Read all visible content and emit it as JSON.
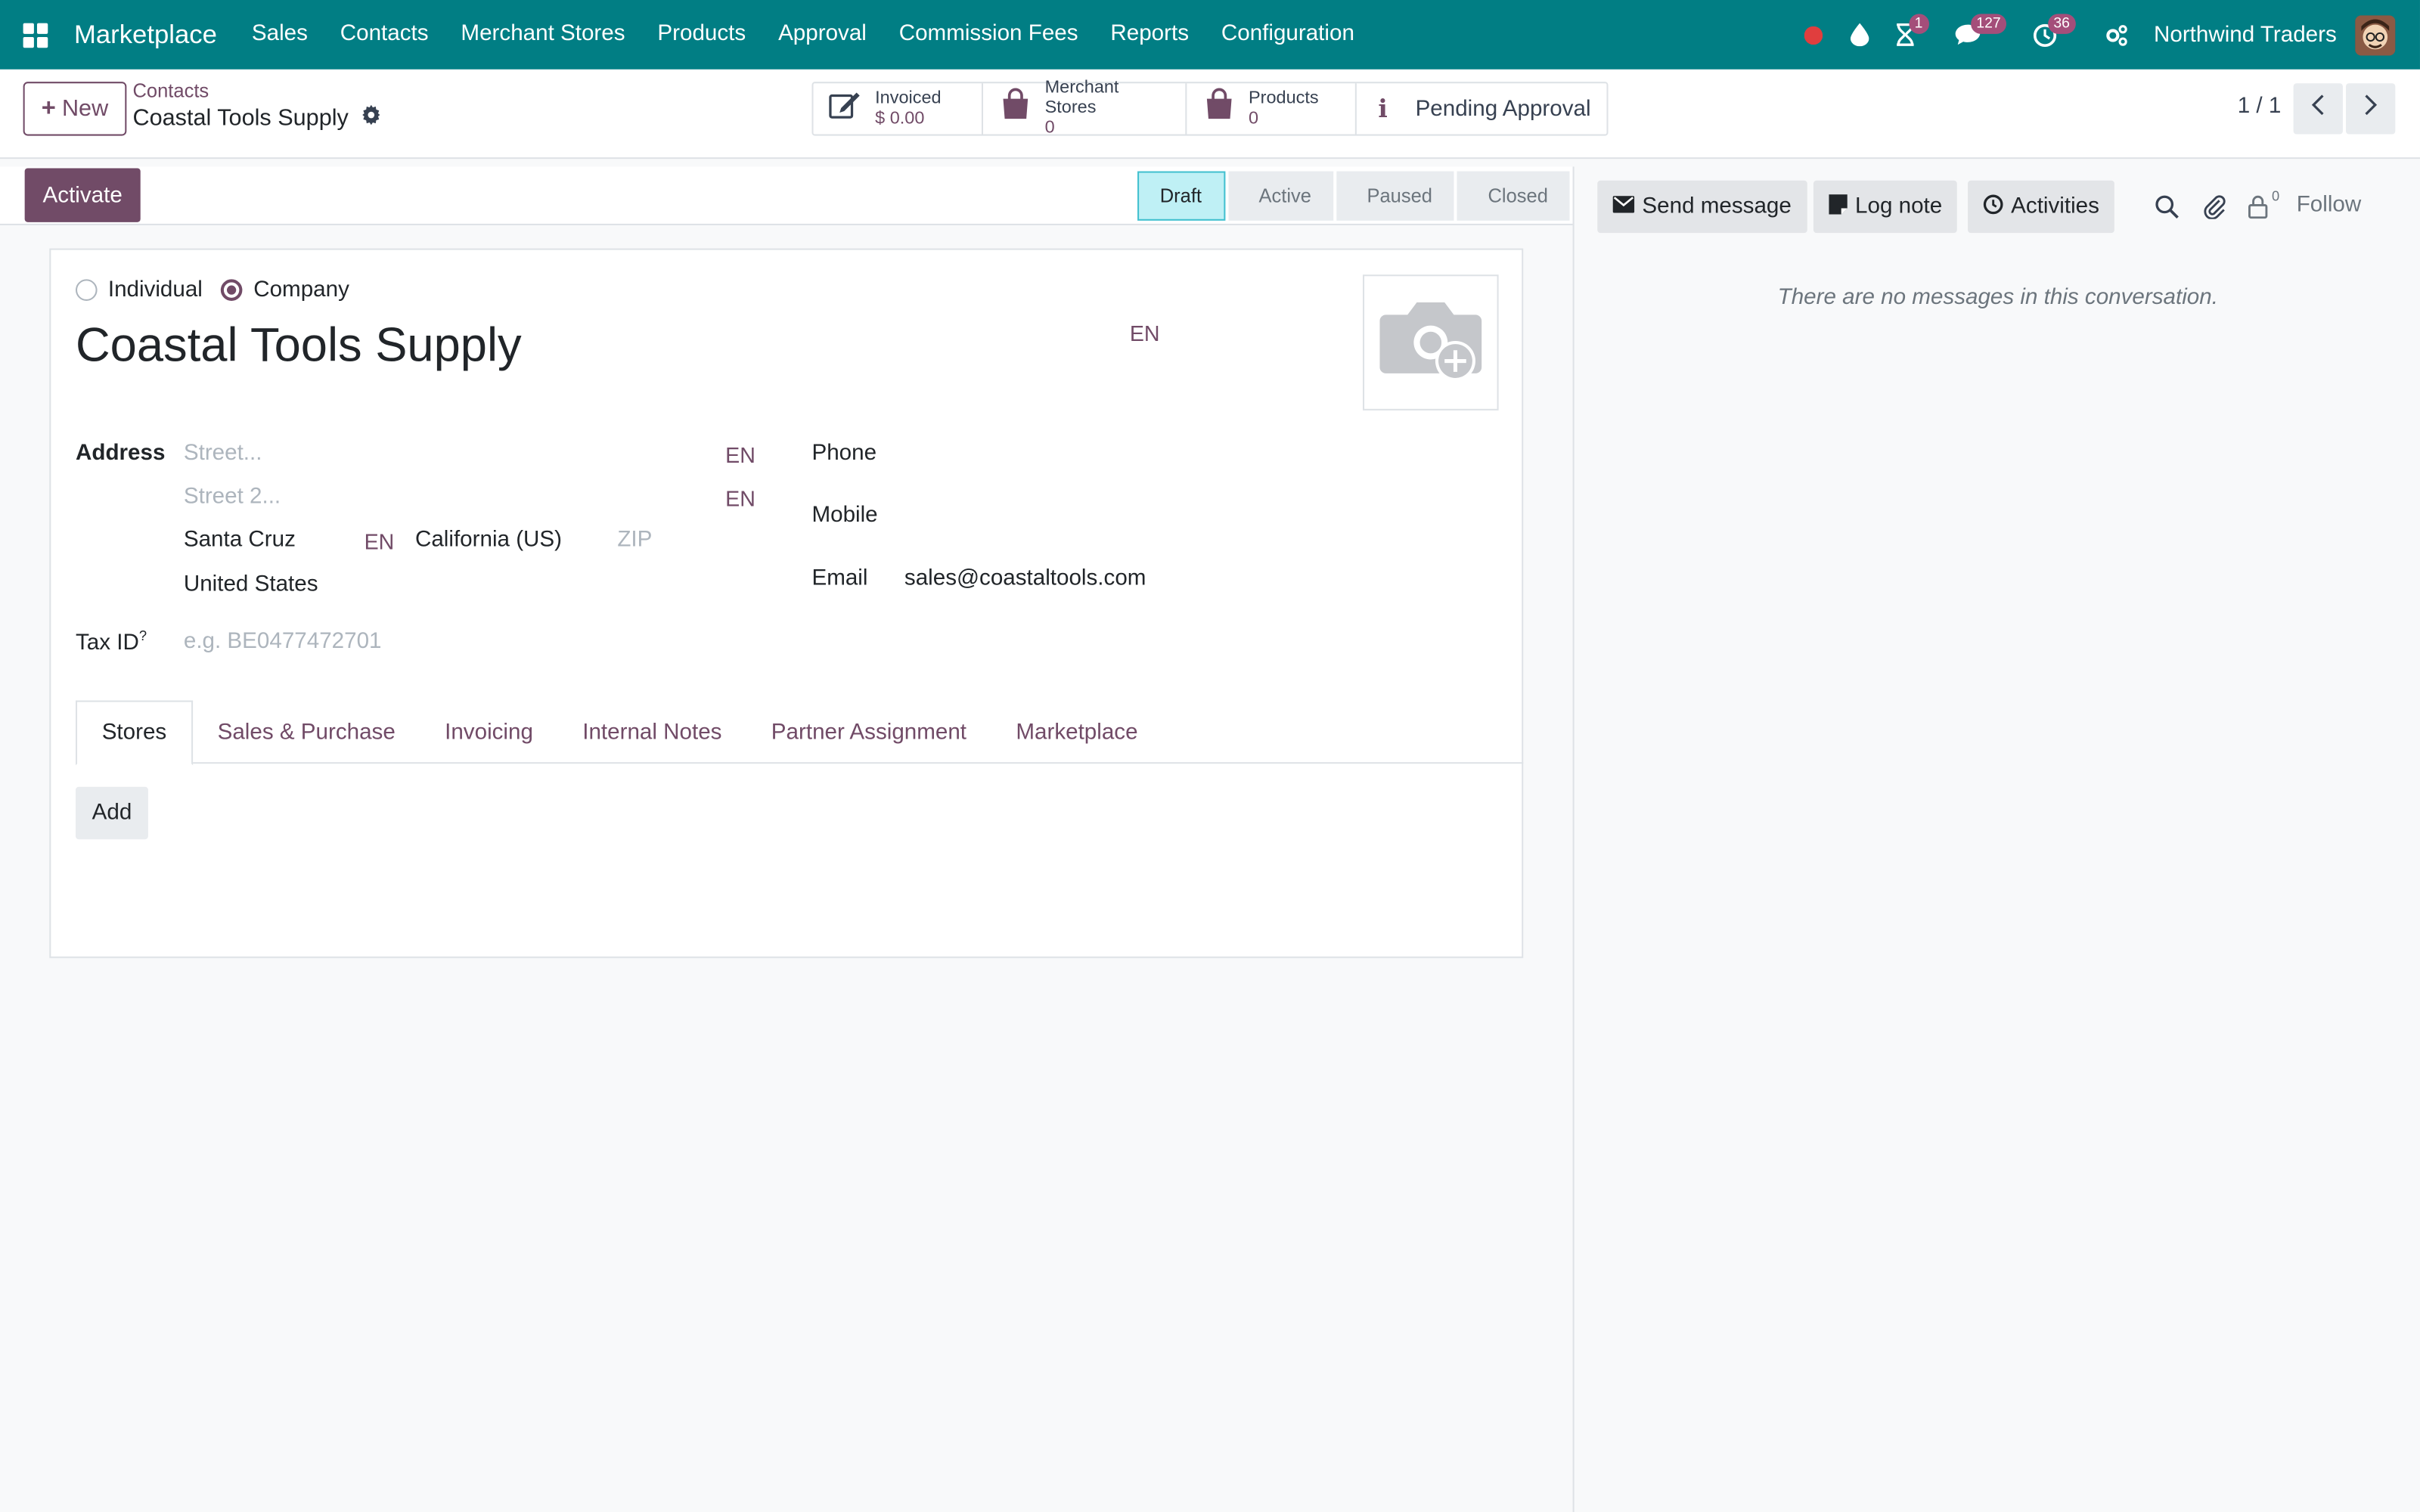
{
  "navbar": {
    "brand": "Marketplace",
    "menu": [
      "Sales",
      "Contacts",
      "Merchant Stores",
      "Products",
      "Approval",
      "Commission Fees",
      "Reports",
      "Configuration"
    ],
    "activity_badge": "1",
    "messages_badge": "127",
    "clock_badge": "36",
    "company": "Northwind Traders",
    "icons": [
      "apps-icon",
      "recording-dot-icon",
      "drop-icon",
      "hourglass-icon",
      "chat-icon",
      "clock-icon",
      "settings-icon"
    ]
  },
  "control": {
    "new_label": "New",
    "breadcrumb_parent": "Contacts",
    "breadcrumb_current": "Coastal Tools Supply",
    "stats": {
      "invoiced_label": "Invoiced",
      "invoiced_value": "$ 0.00",
      "stores_label": "Merchant Stores",
      "stores_value": "0",
      "products_label": "Products",
      "products_value": "0",
      "pending_label": "Pending Approval"
    },
    "pager": "1 / 1"
  },
  "statusbar": {
    "activate_label": "Activate",
    "stages": [
      "Draft",
      "Active",
      "Paused",
      "Closed"
    ],
    "current_stage": "Draft"
  },
  "form": {
    "type_individual": "Individual",
    "type_company": "Company",
    "selected_type": "Company",
    "name": "Coastal Tools Supply",
    "lang_tag": "EN",
    "address_label": "Address",
    "street_placeholder": "Street...",
    "street2_placeholder": "Street 2...",
    "city": "Santa Cruz",
    "state": "California (US)",
    "zip_placeholder": "ZIP",
    "country": "United States",
    "tax_label": "Tax ID",
    "tax_help": "?",
    "tax_placeholder": "e.g. BE0477472701",
    "phone_label": "Phone",
    "mobile_label": "Mobile",
    "email_label": "Email",
    "email": "sales@coastaltools.com"
  },
  "tabs": [
    "Stores",
    "Sales & Purchase",
    "Invoicing",
    "Internal Notes",
    "Partner Assignment",
    "Marketplace"
  ],
  "active_tab": "Stores",
  "stores_tab": {
    "add_label": "Add"
  },
  "chatter": {
    "send_message": "Send message",
    "log_note": "Log note",
    "activities": "Activities",
    "followers_count": "0",
    "follow": "Follow",
    "empty": "There are no messages in this conversation."
  },
  "colors": {
    "navbar": "#017e84",
    "primary": "#714b67",
    "stage_active": "#bff0f5"
  }
}
